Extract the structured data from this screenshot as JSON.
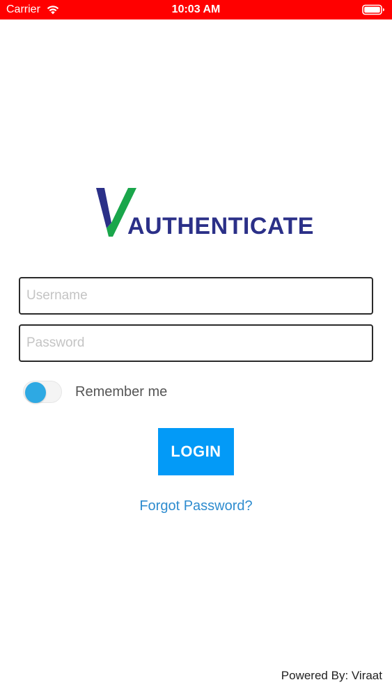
{
  "status_bar": {
    "carrier": "Carrier",
    "time": "10:03 AM",
    "background_color": "#ff0000",
    "wifi_icon": "wifi-icon",
    "battery_icon": "battery-icon"
  },
  "logo": {
    "text": "AUTHENTICATE",
    "mark_icon": "checkmark-v-icon",
    "colors": {
      "dark": "#2b3088",
      "green": "#1aa64b"
    }
  },
  "form": {
    "username": {
      "placeholder": "Username",
      "value": ""
    },
    "password": {
      "placeholder": "Password",
      "value": ""
    },
    "remember_label": "Remember me",
    "remember_on": false,
    "login_label": "LOGIN",
    "forgot_label": "Forgot Password?"
  },
  "footer": {
    "text": "Powered By: Viraat"
  },
  "colors": {
    "accent": "#039af7",
    "link": "#2e8ccf",
    "toggle_knob": "#2ea9e3"
  }
}
